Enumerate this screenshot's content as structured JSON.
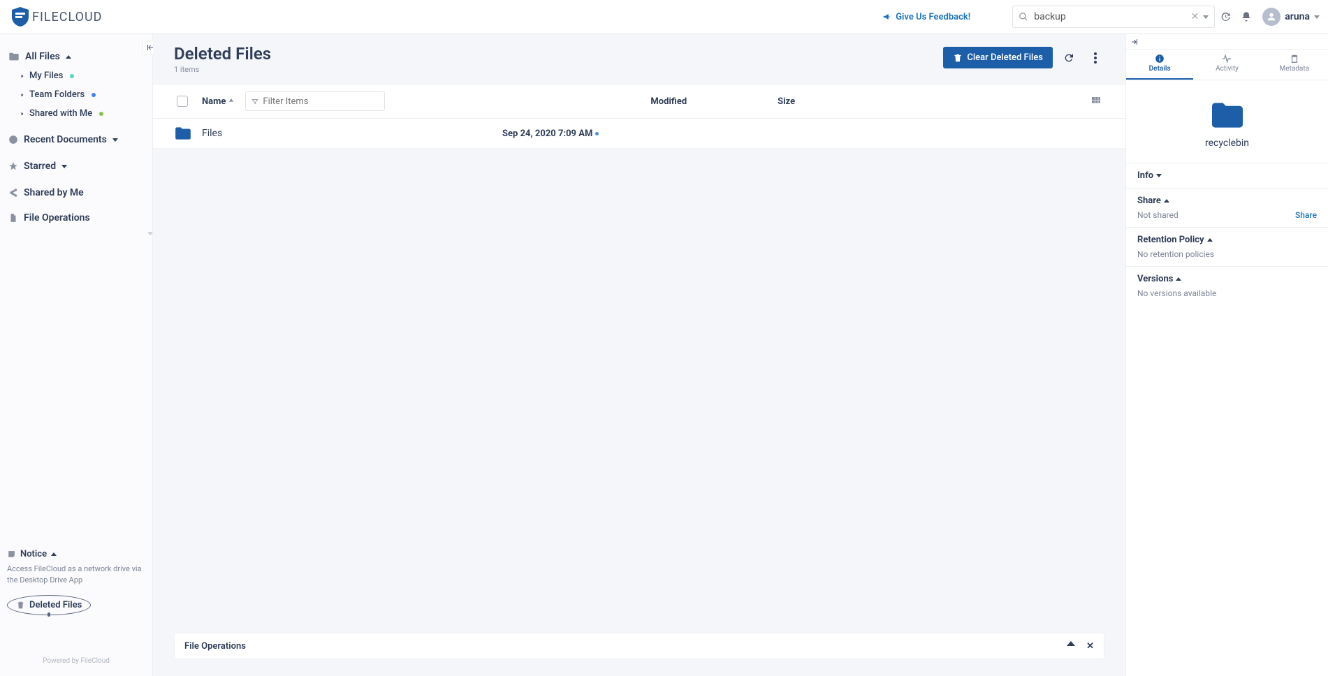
{
  "header": {
    "logo_text": "FILECLOUD",
    "feedback": "Give Us Feedback!",
    "search_value": "backup",
    "user_name": "aruna"
  },
  "sidebar": {
    "all_files": "All Files",
    "my_files": "My Files",
    "team_folders": "Team Folders",
    "shared_with_me": "Shared with Me",
    "recent": "Recent Documents",
    "starred": "Starred",
    "shared_by_me": "Shared by Me",
    "file_ops": "File Operations",
    "notice_label": "Notice",
    "notice_text": "Access FileCloud as a network drive via the Desktop Drive App",
    "deleted_files": "Deleted Files",
    "powered": "Powered by FileCloud"
  },
  "page": {
    "title": "Deleted Files",
    "count": "1 items",
    "clear_btn": "Clear Deleted Files",
    "cols": {
      "name": "Name",
      "modified": "Modified",
      "size": "Size"
    },
    "filter_placeholder": "Filter Items",
    "rows": [
      {
        "name": "Files",
        "modified": "Sep 24, 2020 7:09 AM"
      }
    ],
    "file_ops_bar": "File Operations"
  },
  "details": {
    "tabs": {
      "details": "Details",
      "activity": "Activity",
      "metadata": "Metadata"
    },
    "folder_name": "recyclebin",
    "info_label": "Info",
    "share_label": "Share",
    "share_status": "Not shared",
    "share_action": "Share",
    "retention_label": "Retention Policy",
    "retention_status": "No retention policies",
    "versions_label": "Versions",
    "versions_status": "No versions available"
  }
}
